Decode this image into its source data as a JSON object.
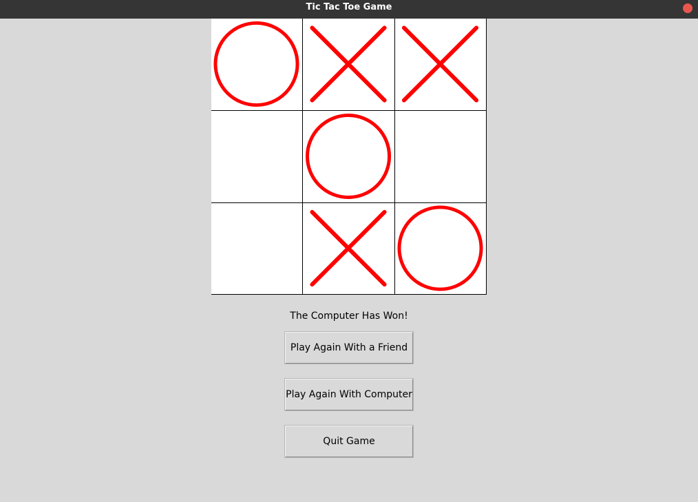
{
  "window": {
    "title": "Tic Tac Toe Game",
    "close_button_color": "#e8574e"
  },
  "board": {
    "mark_color": "#ff0000",
    "cells": [
      [
        "O",
        "X",
        "X"
      ],
      [
        "",
        "O",
        ""
      ],
      [
        "",
        "X",
        "O"
      ]
    ]
  },
  "status": {
    "message": "The Computer Has Won!"
  },
  "buttons": {
    "play_friend": "Play Again With a Friend",
    "play_computer": "Play Again With Computer",
    "quit": "Quit Game"
  }
}
